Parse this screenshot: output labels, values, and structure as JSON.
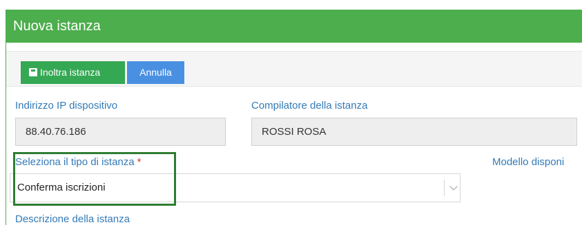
{
  "panel": {
    "title": "Nuova istanza"
  },
  "toolbar": {
    "forward_label": "Inoltra istanza",
    "cancel_label": "Annulla"
  },
  "fields": {
    "ip_label": "Indirizzo IP dispositivo",
    "ip_value": "88.40.76.186",
    "compiler_label": "Compilatore della istanza",
    "compiler_value": "ROSSI ROSA",
    "type_label": "Seleziona il tipo di istanza",
    "type_required_mark": "*",
    "type_selected": "Conferma iscrizioni",
    "model_label": "Modello disponi",
    "description_label": "Descrizione della istanza"
  },
  "icons": {
    "forward": "save-icon",
    "select": "chevron-down-icon"
  },
  "colors": {
    "header": "#4cae4c",
    "forward_button": "#34a853",
    "cancel_button": "#4a90e2",
    "label": "#337ab7",
    "required": "#d9342b",
    "highlight": "#2e7d32"
  }
}
